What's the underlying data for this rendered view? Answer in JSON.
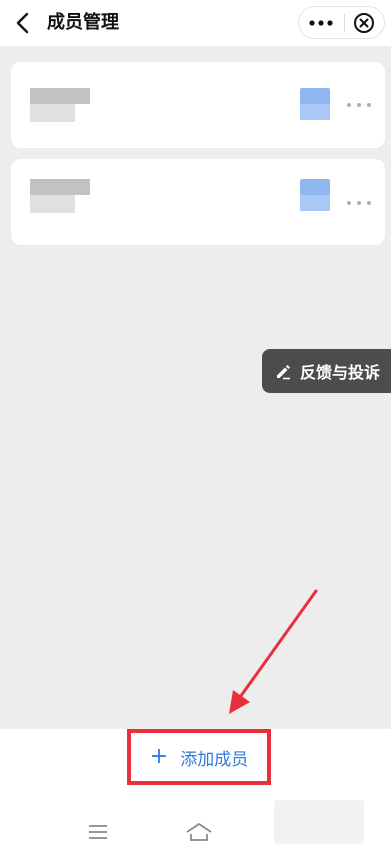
{
  "header": {
    "title": "成员管理",
    "icons": {
      "back": "chevron-left-icon",
      "more": "more-dots-icon",
      "close": "close-circle-icon"
    }
  },
  "members": [
    {
      "name": "",
      "role": ""
    },
    {
      "name": "",
      "role": ""
    }
  ],
  "feedback": {
    "label": "反馈与投诉",
    "icon": "edit-pencil-icon"
  },
  "add_member": {
    "plus": "+",
    "label": "添加成员"
  },
  "colors": {
    "accent_blue": "#2f7be0",
    "annotation_red": "#e8303c",
    "feedback_bg": "#4c4c4c",
    "page_bg": "#ededed"
  },
  "system_nav": {
    "icons": [
      "menu-icon",
      "home-icon"
    ]
  }
}
